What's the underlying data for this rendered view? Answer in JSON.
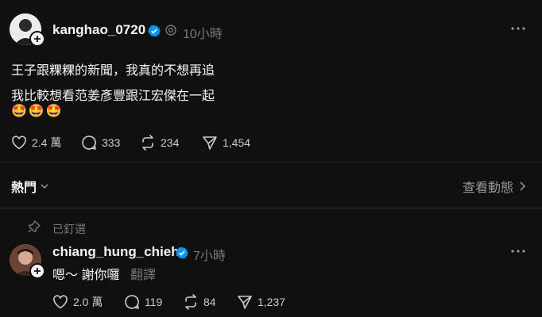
{
  "post": {
    "username": "kanghao_0720",
    "time": "10小時",
    "line1": "王子跟粿粿的新聞，我真的不想再追",
    "line2": "我比較想看范姜彥豐跟江宏傑在一起",
    "emojis": "🤩🤩🤩",
    "likes": "2.4 萬",
    "replies": "333",
    "reposts": "234",
    "shares": "1,454"
  },
  "sort": {
    "label": "熱門",
    "view_activity": "查看動態"
  },
  "reply": {
    "pinned_label": "已釘選",
    "username": "chiang_hung_chieh",
    "time": "7小時",
    "text": "嗯～ 謝你囉",
    "translate": "翻譯",
    "likes": "2.0 萬",
    "replies": "119",
    "reposts": "84",
    "shares": "1,237"
  },
  "colors": {
    "background": "#101010",
    "verified": "#0095f6",
    "text": "#f3f5f7",
    "muted": "#777777"
  }
}
